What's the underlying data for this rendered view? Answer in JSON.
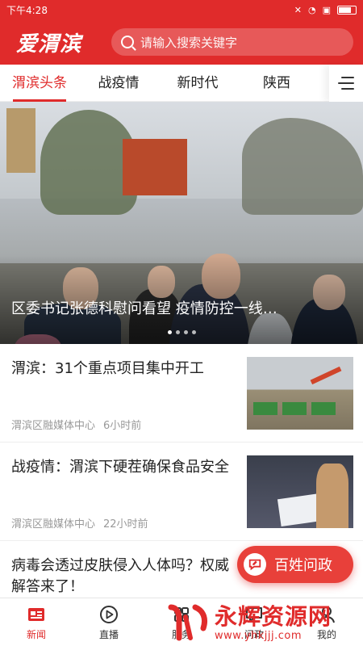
{
  "status_bar": {
    "time": "下午4:28"
  },
  "header": {
    "logo": "爱渭滨",
    "search_placeholder": "请输入搜索关键字"
  },
  "tabs": [
    {
      "label": "渭滨头条",
      "active": true
    },
    {
      "label": "战疫情",
      "active": false
    },
    {
      "label": "新时代",
      "active": false
    },
    {
      "label": "陕西",
      "active": false
    }
  ],
  "banner": {
    "caption": "区委书记张德科慰问看望 疫情防控一线…",
    "slide_count": 4,
    "active_slide": 0
  },
  "news": [
    {
      "title": "渭滨：31个重点项目集中开工",
      "source": "渭滨区融媒体中心",
      "time": "6小时前"
    },
    {
      "title": "战疫情：渭滨下硬茬确保食品安全",
      "source": "渭滨区融媒体中心",
      "time": "22小时前"
    },
    {
      "title": "病毒会透过皮肤侵入人体吗？权威解答来了！"
    }
  ],
  "fab": {
    "label": "百姓问政"
  },
  "bottom_nav": [
    {
      "label": "新闻",
      "icon": "news-icon",
      "active": true
    },
    {
      "label": "直播",
      "icon": "play-icon",
      "active": false
    },
    {
      "label": "服务",
      "icon": "service-icon",
      "active": false
    },
    {
      "label": "问政",
      "icon": "ask-icon",
      "active": false
    },
    {
      "label": "我的",
      "icon": "user-icon",
      "active": false
    }
  ],
  "watermark": {
    "title": "永辉资源网",
    "url": "www.yhkjjj.com"
  },
  "colors": {
    "brand_red": "#e02b2b"
  }
}
